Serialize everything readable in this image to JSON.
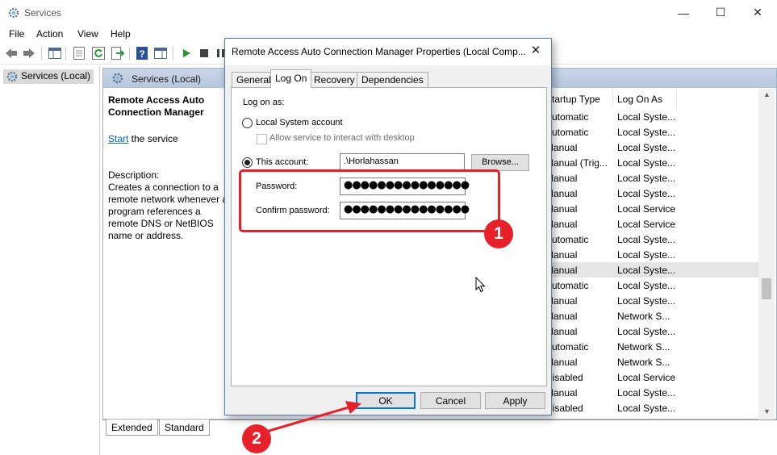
{
  "window": {
    "title": "Services",
    "minimize": "—",
    "maximize": "☐",
    "close": "✕"
  },
  "menu": [
    "File",
    "Action",
    "View",
    "Help"
  ],
  "tree": {
    "root_label": "Services (Local)"
  },
  "pane": {
    "header": "Services (Local)",
    "service_title": "Remote Access Auto Connection Manager",
    "start_link": "Start",
    "start_suffix": " the service",
    "description_label": "Description:",
    "description_text": "Creates a connection to a remote network whenever a program references a remote DNS or NetBIOS name or address."
  },
  "columns": {
    "startup_type": "Startup Type",
    "log_on_as": "Log On As"
  },
  "rows": [
    {
      "startup": "Automatic",
      "logon": "Local Syste..."
    },
    {
      "startup": "Automatic",
      "logon": "Local Syste..."
    },
    {
      "startup": "Manual",
      "logon": "Local Syste..."
    },
    {
      "startup": "Manual (Trig...",
      "logon": "Local Syste..."
    },
    {
      "startup": "Manual",
      "logon": "Local Syste..."
    },
    {
      "startup": "Manual",
      "logon": "Local Syste..."
    },
    {
      "startup": "Manual",
      "logon": "Local Service"
    },
    {
      "startup": "Manual",
      "logon": "Local Service"
    },
    {
      "startup": "Automatic",
      "logon": "Local Syste..."
    },
    {
      "startup": "Manual",
      "logon": "Local Syste..."
    },
    {
      "startup": "Manual",
      "logon": "Local Syste..."
    },
    {
      "startup": "Automatic",
      "logon": "Local Syste..."
    },
    {
      "startup": "Manual",
      "logon": "Local Syste..."
    },
    {
      "startup": "Manual",
      "logon": "Network S..."
    },
    {
      "startup": "Manual",
      "logon": "Local Syste..."
    },
    {
      "startup": "Automatic",
      "logon": "Network S..."
    },
    {
      "startup": "Manual",
      "logon": "Network S..."
    },
    {
      "startup": "Disabled",
      "logon": "Local Service"
    },
    {
      "startup": "Manual",
      "logon": "Local Syste..."
    },
    {
      "startup": "Disabled",
      "logon": "Local Syste..."
    }
  ],
  "bottom_tabs": {
    "extended": "Extended",
    "standard": "Standard"
  },
  "dialog": {
    "title": "Remote Access Auto Connection Manager Properties (Local Comp...",
    "close": "✕",
    "tabs": {
      "general": "General",
      "logon": "Log On",
      "recovery": "Recovery",
      "dependencies": "Dependencies"
    },
    "logon_as": "Log on as:",
    "local_system": "Local System account",
    "allow_interact": "Allow service to interact with desktop",
    "this_account": "This account:",
    "account_value": ".\\Horlahassan",
    "browse": "Browse...",
    "password_label": "Password:",
    "password_value": "●●●●●●●●●●●●●●●",
    "confirm_label": "Confirm password:",
    "confirm_value": "●●●●●●●●●●●●●●●",
    "ok": "OK",
    "cancel": "Cancel",
    "apply": "Apply"
  },
  "annotations": {
    "badge1": "1",
    "badge2": "2",
    "color": "#e8202a"
  }
}
